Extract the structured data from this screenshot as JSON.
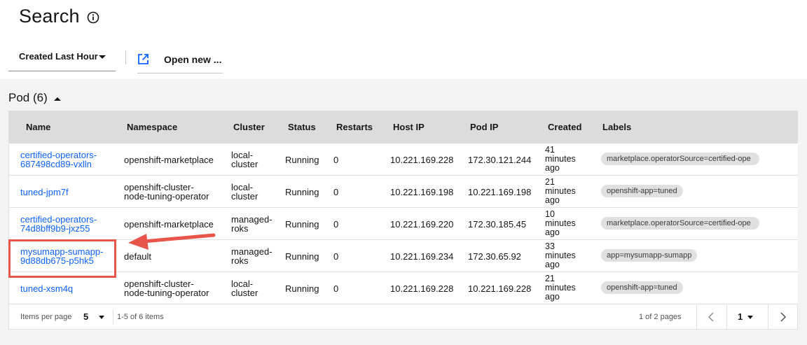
{
  "page": {
    "title": "Search"
  },
  "toolbar": {
    "time_filter": "Created Last Hour",
    "open_new_label": "Open new ..."
  },
  "section": {
    "title": "Pod (6)"
  },
  "table": {
    "headers": [
      "Name",
      "Namespace",
      "Cluster",
      "Status",
      "Restarts",
      "Host IP",
      "Pod IP",
      "Created",
      "Labels"
    ],
    "rows": [
      {
        "name": [
          "certified-operators-",
          "687498cd89-vxlln"
        ],
        "namespace": [
          "openshift-marketplace"
        ],
        "cluster": [
          "local-",
          "cluster"
        ],
        "status": "Running",
        "restarts": "0",
        "host_ip": "10.221.169.228",
        "pod_ip": "172.30.121.244",
        "created": [
          "41",
          "minutes",
          "ago"
        ],
        "label": "marketplace.operatorSource=certified-ope"
      },
      {
        "name": [
          "tuned-jpm7f"
        ],
        "namespace": [
          "openshift-cluster-",
          "node-tuning-operator"
        ],
        "cluster": [
          "local-",
          "cluster"
        ],
        "status": "Running",
        "restarts": "0",
        "host_ip": "10.221.169.198",
        "pod_ip": "10.221.169.198",
        "created": [
          "21",
          "minutes",
          "ago"
        ],
        "label": "openshift-app=tuned"
      },
      {
        "name": [
          "certified-operators-",
          "74d8bff9b9-jxz55"
        ],
        "namespace": [
          "openshift-marketplace"
        ],
        "cluster": [
          "managed-",
          "roks"
        ],
        "status": "Running",
        "restarts": "0",
        "host_ip": "10.221.169.220",
        "pod_ip": "172.30.185.45",
        "created": [
          "10",
          "minutes",
          "ago"
        ],
        "label": "marketplace.operatorSource=certified-ope"
      },
      {
        "name": [
          "mysumapp-sumapp-",
          "9d88db675-p5hk5"
        ],
        "namespace": [
          "default"
        ],
        "cluster": [
          "managed-",
          "roks"
        ],
        "status": "Running",
        "restarts": "0",
        "host_ip": "10.221.169.234",
        "pod_ip": "172.30.65.92",
        "created": [
          "33",
          "minutes",
          "ago"
        ],
        "label": "app=mysumapp-sumapp"
      },
      {
        "name": [
          "tuned-xsm4q"
        ],
        "namespace": [
          "openshift-cluster-",
          "node-tuning-operator"
        ],
        "cluster": [
          "local-",
          "cluster"
        ],
        "status": "Running",
        "restarts": "0",
        "host_ip": "10.221.169.228",
        "pod_ip": "10.221.169.228",
        "created": [
          "21",
          "minutes",
          "ago"
        ],
        "label": "openshift-app=tuned"
      }
    ]
  },
  "pagination": {
    "items_per_page_label": "Items per page",
    "items_per_page": "5",
    "range_text": "1-5 of 6 items",
    "pages_text": "1 of 2 pages",
    "current_page": "1"
  },
  "colors": {
    "link": "#0f62fe",
    "header_bg": "#dcdcdc",
    "annotation": "#e8564b",
    "page_bg": "#f3f3f3"
  },
  "icons": {
    "title_info": "info-icon",
    "open_new": "launch-icon",
    "prev": "chevron-left-icon",
    "next": "chevron-right-icon"
  }
}
